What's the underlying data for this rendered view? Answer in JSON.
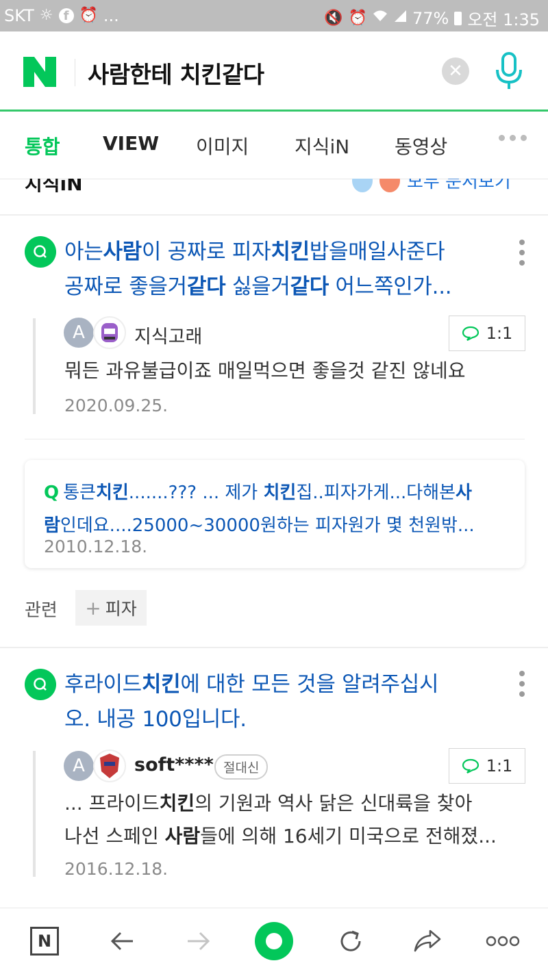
{
  "status_bar": {
    "carrier": "SKT",
    "ellipsis": "...",
    "battery": "77%",
    "time": "오전 1:35"
  },
  "search": {
    "query": "사람한테 치킨같다",
    "logo": "N"
  },
  "tabs": [
    "통합",
    "VIEW",
    "이미지",
    "지식iN",
    "동영상"
  ],
  "partial_section": {
    "title": "지식iN",
    "see_all": "모두 문서보기"
  },
  "results": [
    {
      "title_parts": [
        {
          "t": "아는",
          "b": false
        },
        {
          "t": "사람",
          "b": true
        },
        {
          "t": "이 공짜로 피자",
          "b": false
        },
        {
          "t": "치킨",
          "b": true
        },
        {
          "t": "밥을매일사준다",
          "b": false
        }
      ],
      "title_parts_2": [
        {
          "t": "공짜로 좋을거",
          "b": false
        },
        {
          "t": "같다",
          "b": true
        },
        {
          "t": " 싫을거",
          "b": false
        },
        {
          "t": "같다",
          "b": true
        },
        {
          "t": " 어느쪽인가...",
          "b": false
        }
      ],
      "username": "지식고래",
      "chat_label": "1:1",
      "answer": "뭐든 과유불급이죠 매일먹으면 좋을것 같진 않네요",
      "date": "2020.09.25."
    },
    {
      "title_parts": [
        {
          "t": "후라이드",
          "b": false
        },
        {
          "t": "치킨",
          "b": true
        },
        {
          "t": "에 대한 모든 것을 알려주십시",
          "b": false
        }
      ],
      "title_line_2": "오. 내공 100입니다.",
      "username": "soft****",
      "badge": "절대신",
      "chat_label": "1:1",
      "answer_parts": [
        {
          "t": "... 프라이드",
          "b": false
        },
        {
          "t": "치킨",
          "b": true
        },
        {
          "t": "의 기원과 역사 닭은 신대륙을 찾아",
          "b": false
        }
      ],
      "answer_parts_2": [
        {
          "t": "나선 스페인 ",
          "b": false
        },
        {
          "t": "사람",
          "b": true
        },
        {
          "t": "들에 의해 16세기 미국으로 전해졌...",
          "b": false
        }
      ],
      "date": "2016.12.18."
    }
  ],
  "related_card": {
    "q": "Q",
    "line1": [
      {
        "t": "통큰",
        "b": false
      },
      {
        "t": "치킨",
        "b": true
      },
      {
        "t": ".......??? ... 제가 ",
        "b": false
      },
      {
        "t": "치킨",
        "b": true
      },
      {
        "t": "집..피자가게...다해본",
        "b": false
      },
      {
        "t": "사",
        "b": true
      }
    ],
    "line2": [
      {
        "t": "람",
        "b": true
      },
      {
        "t": "인데요....25000~30000원하는 피자원가 몇 천원밖...",
        "b": false
      }
    ],
    "date": "2010.12.18."
  },
  "related": {
    "label": "관련",
    "chip": "피자"
  },
  "icons": {
    "clear": "close-icon",
    "mic": "microphone-icon",
    "back": "arrow-left-icon",
    "forward": "arrow-right-icon",
    "refresh": "refresh-icon",
    "share": "share-icon",
    "more": "more-icon"
  },
  "colors": {
    "naver_green": "#03c75a",
    "link_blue": "#0c57b5"
  }
}
